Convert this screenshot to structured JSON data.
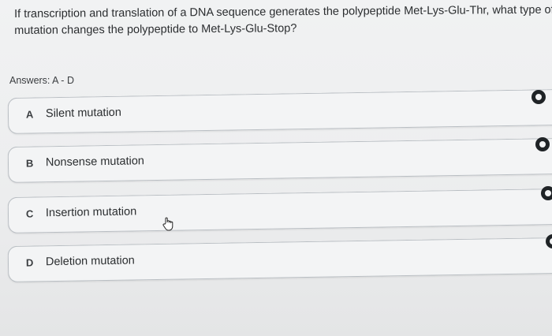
{
  "question": {
    "text": "If transcription and translation of a DNA sequence generates the polypeptide Met-Lys-Glu-Thr, what type of mutation changes the polypeptide to Met-Lys-Glu-Stop?"
  },
  "answers": {
    "label": "Answers: A - D",
    "options": [
      {
        "letter": "A",
        "text": "Silent mutation"
      },
      {
        "letter": "B",
        "text": "Nonsense mutation"
      },
      {
        "letter": "C",
        "text": "Insertion mutation"
      },
      {
        "letter": "D",
        "text": "Deletion mutation"
      }
    ]
  },
  "icons": {
    "radio": "radio-button-icon",
    "cursor": "hand-pointer-icon"
  },
  "colors": {
    "background": "#eef0f2",
    "option_border": "#b9bec3",
    "text": "#2b2e30",
    "radio": "#1f2326"
  }
}
